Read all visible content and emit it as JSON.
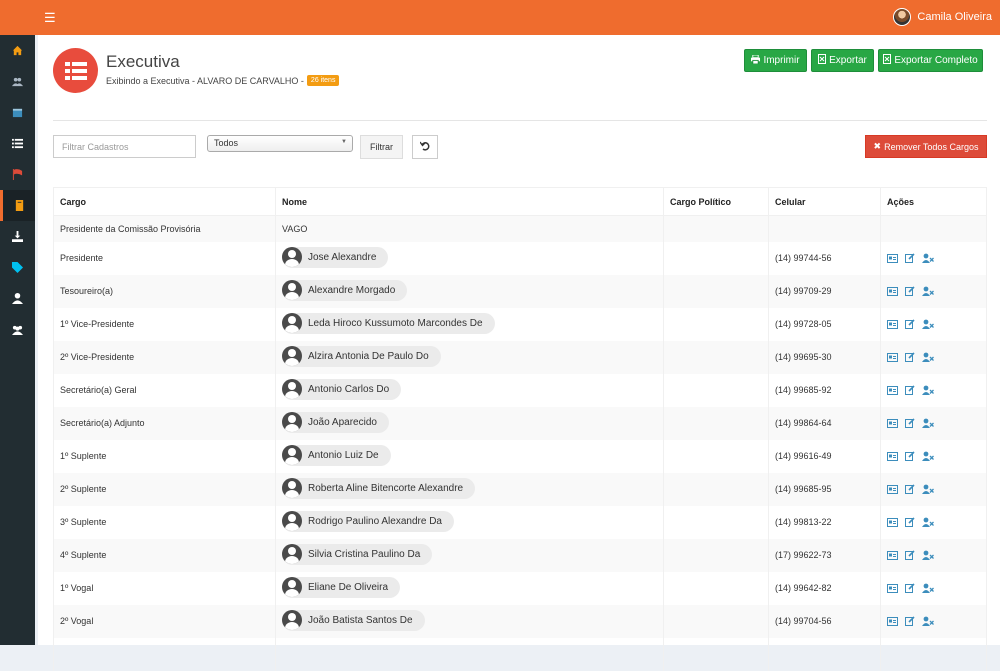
{
  "topbar": {
    "user_name": "Camila Oliveira"
  },
  "sidebar": {
    "items": [
      {
        "icon": "home-icon",
        "color": "#f39c12"
      },
      {
        "icon": "users-icon",
        "color": "#aab7c4"
      },
      {
        "icon": "calendar-icon",
        "color": "#3c8dbc"
      },
      {
        "icon": "list-icon",
        "color": "#fff"
      },
      {
        "icon": "flag-icon",
        "color": "#dd4b39"
      },
      {
        "icon": "book-icon",
        "color": "#f39c12",
        "active": true
      },
      {
        "icon": "download-icon",
        "color": "#fff"
      },
      {
        "icon": "tag-icon",
        "color": "#00c0ef"
      },
      {
        "icon": "user-icon",
        "color": "#fff"
      },
      {
        "icon": "group-icon",
        "color": "#fff"
      }
    ]
  },
  "header": {
    "title": "Executiva",
    "subtitle": "Exibindo a Executiva - ALVARO DE CARVALHO -",
    "badge": "26 itens"
  },
  "toolbar": {
    "print_label": "Imprimir",
    "export_label": "Exportar",
    "export_full_label": "Exportar Completo"
  },
  "filters": {
    "search_placeholder": "Filtrar Cadastros",
    "select_value": "Todos",
    "filter_label": "Filtrar",
    "remove_all_label": "Remover Todos Cargos"
  },
  "table": {
    "headers": [
      "Cargo",
      "Nome",
      "Cargo Político",
      "Celular",
      "Ações"
    ],
    "first_row": {
      "cargo": "Presidente da Comissão Provisória",
      "nome": "VAGO"
    },
    "rows": [
      {
        "cargo": "Presidente",
        "nome": "Jose Alexandre",
        "celular": "(14) 99744-56"
      },
      {
        "cargo": "Tesoureiro(a)",
        "nome": "Alexandre Morgado",
        "celular": "(14) 99709-29"
      },
      {
        "cargo": "1º Vice-Presidente",
        "nome": "Leda Hiroco Kussumoto Marcondes De",
        "celular": "(14) 99728-05"
      },
      {
        "cargo": "2º Vice-Presidente",
        "nome": "Alzira Antonia De Paulo Do",
        "celular": "(14) 99695-30"
      },
      {
        "cargo": "Secretário(a) Geral",
        "nome": "Antonio Carlos Do",
        "celular": "(14) 99685-92"
      },
      {
        "cargo": "Secretário(a) Adjunto",
        "nome": "João Aparecido",
        "celular": "(14) 99864-64"
      },
      {
        "cargo": "1º Suplente",
        "nome": "Antonio Luiz De",
        "celular": "(14) 99616-49"
      },
      {
        "cargo": "2º Suplente",
        "nome": "Roberta Aline Bitencorte Alexandre",
        "celular": "(14) 99685-95"
      },
      {
        "cargo": "3º Suplente",
        "nome": "Rodrigo Paulino Alexandre Da",
        "celular": "(14) 99813-22"
      },
      {
        "cargo": "4º Suplente",
        "nome": "Silvia Cristina Paulino Da",
        "celular": "(17) 99622-73"
      },
      {
        "cargo": "1º Vogal",
        "nome": "Eliane De Oliveira",
        "celular": "(14) 99642-82"
      },
      {
        "cargo": "2º Vogal",
        "nome": "João Batista Santos De",
        "celular": "(14) 99704-56"
      },
      {
        "cargo": "",
        "nome": "",
        "celular": ""
      }
    ]
  },
  "colors": {
    "topbar": "#ef6c2e",
    "sidebar": "#222d32",
    "green": "#28a745",
    "red": "#dd4b39",
    "action_blue": "#3c8dbc"
  }
}
